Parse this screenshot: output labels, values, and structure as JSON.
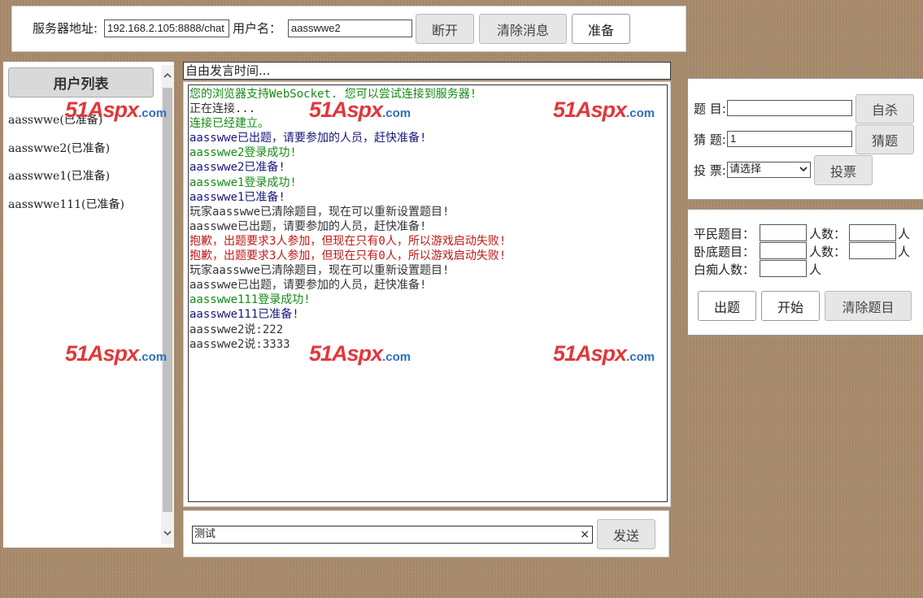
{
  "top_bar": {
    "server_label": "服务器地址:",
    "server_value": "192.168.2.105:8888/chat",
    "username_label": "用户名：",
    "username_value": "aasswwe2",
    "disconnect_label": "断开",
    "clear_messages_label": "清除消息",
    "ready_label": "准备"
  },
  "user_list": {
    "header": "用户列表",
    "users": [
      "aasswwe(已准备)",
      "aasswwe2(已准备)",
      "aasswwe1(已准备)",
      "aasswwe111(已准备)"
    ]
  },
  "chat": {
    "status": "自由发言时间...",
    "messages": [
      {
        "text": "您的浏览器支持WebSocket. 您可以尝试连接到服务器!",
        "color": "#158a15"
      },
      {
        "text": "正在连接...",
        "color": "#333333"
      },
      {
        "text": "连接已经建立。",
        "color": "#158a15"
      },
      {
        "text": "aasswwe已出题，请要参加的人员，赶快准备!",
        "color": "#17177a"
      },
      {
        "text": "aasswwe2登录成功!",
        "color": "#158a15"
      },
      {
        "text": "aasswwe2已准备!",
        "color": "#17177a"
      },
      {
        "text": "aasswwe1登录成功!",
        "color": "#158a15"
      },
      {
        "text": "aasswwe1已准备!",
        "color": "#17177a"
      },
      {
        "text": "玩家aasswwe已清除题目，现在可以重新设置题目!",
        "color": "#333333"
      },
      {
        "text": "aasswwe已出题，请要参加的人员，赶快准备!",
        "color": "#333333"
      },
      {
        "text": "抱歉，出题要求3人参加，但现在只有0人，所以游戏启动失败!",
        "color": "#c01818"
      },
      {
        "text": "抱歉，出题要求3人参加，但现在只有0人，所以游戏启动失败!",
        "color": "#c01818"
      },
      {
        "text": "玩家aasswwe已清除题目，现在可以重新设置题目!",
        "color": "#333333"
      },
      {
        "text": "aasswwe已出题，请要参加的人员，赶快准备!",
        "color": "#333333"
      },
      {
        "text": "aasswwe111登录成功!",
        "color": "#158a15"
      },
      {
        "text": "aasswwe111已准备!",
        "color": "#17177a"
      },
      {
        "text": "aasswwe2说:222",
        "color": "#333333"
      },
      {
        "text": "aasswwe2说:3333",
        "color": "#333333"
      }
    ],
    "input_value": "测试",
    "clear_glyph": "×",
    "send_label": "发送"
  },
  "quiz": {
    "topic_label": "题 目:",
    "topic_value": "",
    "suicide_label": "自杀",
    "guess_label": "猜 题:",
    "guess_value": "1",
    "guess_button": "猜题",
    "vote_label": "投 票:",
    "vote_selected": "请选择",
    "vote_button": "投票"
  },
  "setup": {
    "civilian_label": "平民题目：",
    "civilian_count_label": "人数：",
    "civilian_unit": "人",
    "undercover_label": "卧底题目：",
    "undercover_count_label": "人数：",
    "undercover_unit": "人",
    "idiot_label": "白痴人数：",
    "idiot_unit": "人",
    "set_question_label": "出题",
    "start_label": "开始",
    "clear_question_label": "清除题目"
  },
  "watermark": {
    "brand": "51Aspx",
    "suffix": ".com"
  }
}
